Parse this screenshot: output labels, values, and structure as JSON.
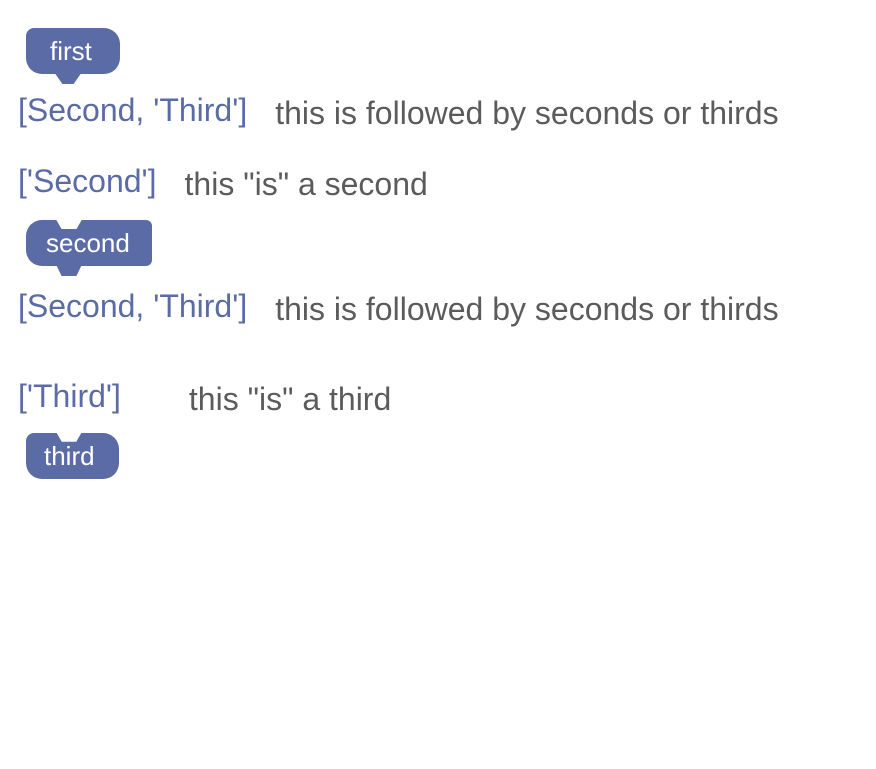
{
  "colors": {
    "block_bg": "#5b6ba6",
    "block_fg": "#ffffff",
    "next_list_fg": "#5b6ba6",
    "tooltip_fg": "#5b5b5b"
  },
  "blocks": {
    "first": {
      "label": "first",
      "next_list": "[Second, 'Third']",
      "tooltip": "this is followed by seconds or thirds"
    },
    "second": {
      "label": "second",
      "prev_list": "['Second']",
      "prev_tooltip": "this \"is\" a second",
      "next_list": "[Second, 'Third']",
      "next_tooltip": "this is followed by seconds or thirds"
    },
    "third": {
      "label": "third",
      "prev_list": "['Third']",
      "prev_tooltip": "this \"is\" a third"
    }
  }
}
